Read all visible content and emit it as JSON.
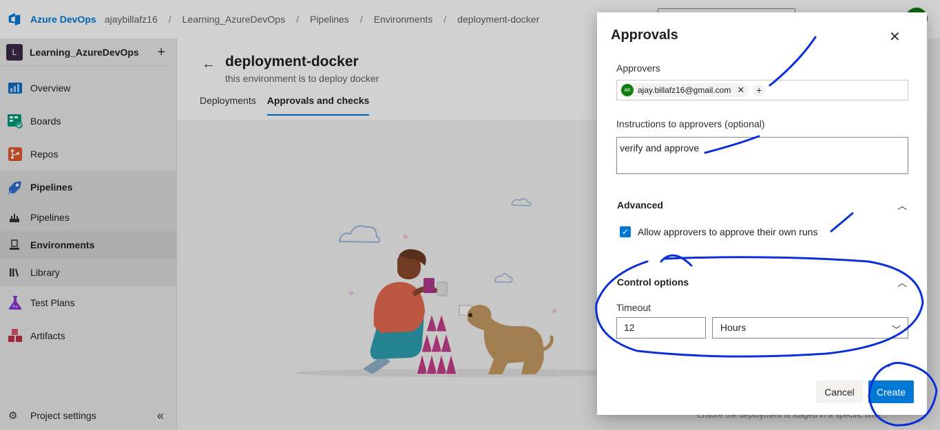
{
  "topbar": {
    "brand": "Azure DevOps",
    "breadcrumbs": [
      "ajaybillafz16",
      "Learning_AzureDevOps",
      "Pipelines",
      "Environments",
      "deployment-docker"
    ],
    "separator": "/"
  },
  "sidebar": {
    "project_initial": "L",
    "project_name": "Learning_AzureDevOps",
    "add_symbol": "+",
    "items": [
      {
        "label": "Overview",
        "icon": "overview-icon"
      },
      {
        "label": "Boards",
        "icon": "boards-icon"
      },
      {
        "label": "Repos",
        "icon": "repos-icon"
      },
      {
        "label": "Pipelines",
        "icon": "pipelines-icon"
      },
      {
        "label": "Pipelines",
        "icon": "pipelines-sub-icon"
      },
      {
        "label": "Environments",
        "icon": "environments-icon"
      },
      {
        "label": "Library",
        "icon": "library-icon"
      },
      {
        "label": "Test Plans",
        "icon": "test-plans-icon"
      },
      {
        "label": "Artifacts",
        "icon": "artifacts-icon"
      }
    ],
    "settings_label": "Project settings",
    "collapse_symbol": "«"
  },
  "main": {
    "back_symbol": "←",
    "title": "deployment-docker",
    "description": "this environment is to deploy docker",
    "tabs": [
      "Deployments",
      "Approvals and checks"
    ],
    "active_tab": "Approvals and checks",
    "partial_text": "Ensure the deployment is staged in a specific time..."
  },
  "dialog": {
    "title": "Approvals",
    "close_symbol": "✕",
    "approvers_label": "Approvers",
    "approver": {
      "initials": "AK",
      "email": "ajay.billafz16@gmail.com"
    },
    "remove_symbol": "✕",
    "add_symbol": "+",
    "instructions_label": "Instructions to approvers (optional)",
    "instructions_value": "verify and approve",
    "advanced_title": "Advanced",
    "allow_self_approval_label": "Allow approvers to approve their own runs",
    "allow_self_approval_checked": true,
    "control_options_title": "Control options",
    "timeout_label": "Timeout",
    "timeout_value": "12",
    "timeout_unit": "Hours",
    "cancel_label": "Cancel",
    "create_label": "Create"
  },
  "colors": {
    "accent": "#0078d4",
    "annotation_ink": "#0a2fd6",
    "avatar_green": "#107c10"
  }
}
